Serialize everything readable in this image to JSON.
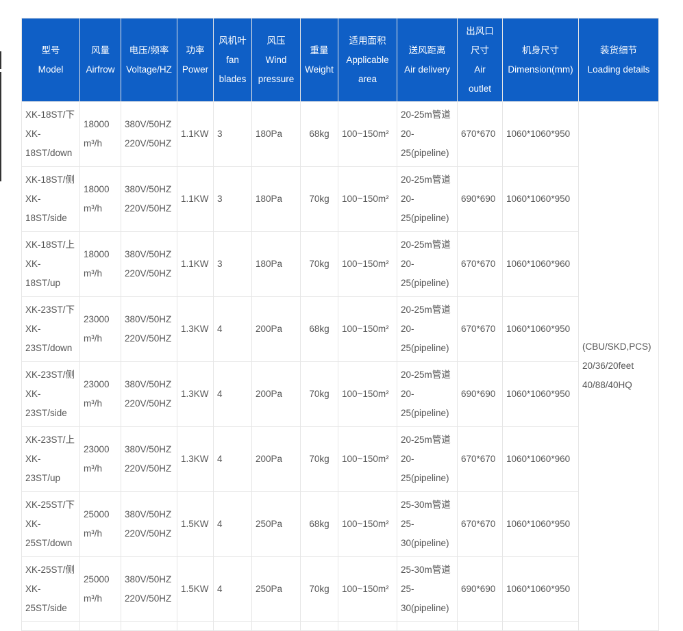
{
  "headers": [
    {
      "zh": "型号",
      "en": "Model"
    },
    {
      "zh": "风量",
      "en": "Airfrow"
    },
    {
      "zh": "电压/频率",
      "en": "Voltage/HZ"
    },
    {
      "zh": "功率",
      "en": "Power"
    },
    {
      "zh": "风机叶",
      "en": "fan",
      "en2": "blades"
    },
    {
      "zh": "风压",
      "en": "Wind",
      "en2": "pressure"
    },
    {
      "zh": "重量",
      "en": "Weight"
    },
    {
      "zh": "适用面积",
      "en": "Applicable",
      "en2": "area"
    },
    {
      "zh": "送风距离",
      "en": "Air delivery"
    },
    {
      "zh": "出风口",
      "zh2": "尺寸",
      "en": "Air",
      "en2": "outlet"
    },
    {
      "zh": "机身尺寸",
      "en": "Dimension(mm)"
    },
    {
      "zh": "装货细节",
      "en": "Loading details"
    }
  ],
  "rows": [
    {
      "model": [
        "XK-18ST/下",
        "XK-",
        "18ST/down"
      ],
      "airflow": [
        "18000",
        "m³/h"
      ],
      "voltage": [
        "380V/50HZ",
        "220V/50HZ"
      ],
      "power": "1.1KW",
      "blades": "3",
      "pressure": "180Pa",
      "weight": "68kg",
      "area": "100~150m²",
      "delivery": [
        "20-25m管道",
        "20-",
        "25(pipeline)"
      ],
      "outlet": "670*670",
      "dimension": "1060*1060*950"
    },
    {
      "model": [
        "XK-18ST/侧",
        "XK-",
        "18ST/side"
      ],
      "airflow": [
        "18000",
        "m³/h"
      ],
      "voltage": [
        "380V/50HZ",
        "220V/50HZ"
      ],
      "power": "1.1KW",
      "blades": "3",
      "pressure": "180Pa",
      "weight": "70kg",
      "area": "100~150m²",
      "delivery": [
        "20-25m管道",
        "20-",
        "25(pipeline)"
      ],
      "outlet": "690*690",
      "dimension": "1060*1060*950"
    },
    {
      "model": [
        "XK-18ST/上",
        "XK-",
        "18ST/up"
      ],
      "airflow": [
        "18000",
        "m³/h"
      ],
      "voltage": [
        "380V/50HZ",
        "220V/50HZ"
      ],
      "power": "1.1KW",
      "blades": "3",
      "pressure": "180Pa",
      "weight": "70kg",
      "area": "100~150m²",
      "delivery": [
        "20-25m管道",
        "20-",
        "25(pipeline)"
      ],
      "outlet": "670*670",
      "dimension": "1060*1060*960"
    },
    {
      "model": [
        "XK-23ST/下",
        "XK-",
        "23ST/down"
      ],
      "airflow": [
        "23000",
        "m³/h"
      ],
      "voltage": [
        "380V/50HZ",
        "220V/50HZ"
      ],
      "power": "1.3KW",
      "blades": "4",
      "pressure": "200Pa",
      "weight": "68kg",
      "area": "100~150m²",
      "delivery": [
        "20-25m管道",
        "20-",
        "25(pipeline)"
      ],
      "outlet": "670*670",
      "dimension": "1060*1060*950"
    },
    {
      "model": [
        "XK-23ST/侧",
        "XK-",
        "23ST/side"
      ],
      "airflow": [
        "23000",
        "m³/h"
      ],
      "voltage": [
        "380V/50HZ",
        "220V/50HZ"
      ],
      "power": "1.3KW",
      "blades": "4",
      "pressure": "200Pa",
      "weight": "70kg",
      "area": "100~150m²",
      "delivery": [
        "20-25m管道",
        "20-",
        "25(pipeline)"
      ],
      "outlet": "690*690",
      "dimension": "1060*1060*950"
    },
    {
      "model": [
        "XK-23ST/上",
        "XK-",
        "23ST/up"
      ],
      "airflow": [
        "23000",
        "m³/h"
      ],
      "voltage": [
        "380V/50HZ",
        "220V/50HZ"
      ],
      "power": "1.3KW",
      "blades": "4",
      "pressure": "200Pa",
      "weight": "70kg",
      "area": "100~150m²",
      "delivery": [
        "20-25m管道",
        "20-",
        "25(pipeline)"
      ],
      "outlet": "670*670",
      "dimension": "1060*1060*960"
    },
    {
      "model": [
        "XK-25ST/下",
        "XK-",
        "25ST/down"
      ],
      "airflow": [
        "25000",
        "m³/h"
      ],
      "voltage": [
        "380V/50HZ",
        "220V/50HZ"
      ],
      "power": "1.5KW",
      "blades": "4",
      "pressure": "250Pa",
      "weight": "68kg",
      "area": "100~150m²",
      "delivery": [
        "25-30m管道",
        "25-",
        "30(pipeline)"
      ],
      "outlet": "670*670",
      "dimension": "1060*1060*950"
    },
    {
      "model": [
        "XK-25ST/侧",
        "XK-",
        "25ST/side"
      ],
      "airflow": [
        "25000",
        "m³/h"
      ],
      "voltage": [
        "380V/50HZ",
        "220V/50HZ"
      ],
      "power": "1.5KW",
      "blades": "4",
      "pressure": "250Pa",
      "weight": "70kg",
      "area": "100~150m²",
      "delivery": [
        "25-30m管道",
        "25-",
        "30(pipeline)"
      ],
      "outlet": "690*690",
      "dimension": "1060*1060*950"
    }
  ],
  "loading": [
    "(CBU/SKD,PCS)",
    "20/36/20feet",
    "40/88/40HQ"
  ],
  "colors": {
    "header_bg": "#0f5fc6",
    "header_text": "#ffffff",
    "body_text": "#555555",
    "border": "#e6e6e6"
  }
}
